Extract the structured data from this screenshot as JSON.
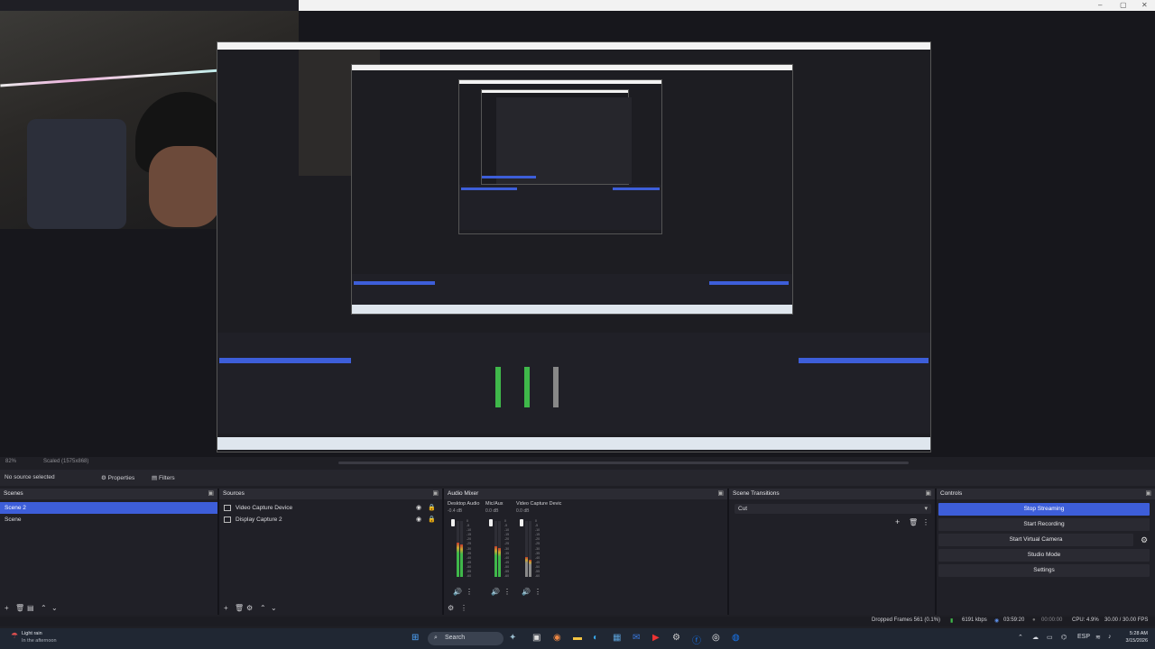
{
  "window": {
    "minimize": "–",
    "maximize": "▢",
    "close": "✕"
  },
  "preview_status": {
    "zoom": "82%",
    "scaled": "Scaled (1575x868)"
  },
  "context_bar": {
    "no_source": "No source selected",
    "properties": "Properties",
    "filters": "Filters"
  },
  "scenes": {
    "title": "Scenes",
    "items": [
      {
        "label": "Scene 2",
        "selected": true
      },
      {
        "label": "Scene",
        "selected": false
      }
    ]
  },
  "sources": {
    "title": "Sources",
    "items": [
      {
        "label": "Video Capture Device"
      },
      {
        "label": "Display Capture 2"
      }
    ]
  },
  "audio_mixer": {
    "title": "Audio Mixer",
    "channels": [
      {
        "name": "Desktop Audio",
        "db": "-0.4 dB",
        "level": 0.62,
        "color": "#3fb84a"
      },
      {
        "name": "Mic/Aux",
        "db": "0.0 dB",
        "level": 0.55,
        "color": "#3fb84a"
      },
      {
        "name": "Video Capture Devic",
        "db": "0.0 dB",
        "level": 0.35,
        "color": "#8a8a8a"
      }
    ],
    "ticks": [
      "0",
      "-5",
      "-10",
      "-15",
      "-20",
      "-25",
      "-30",
      "-35",
      "-40",
      "-45",
      "-50",
      "-55",
      "-60"
    ]
  },
  "scene_transitions": {
    "title": "Scene Transitions",
    "transition": "Cut"
  },
  "controls": {
    "title": "Controls",
    "buttons": [
      "Stop Streaming",
      "Start Recording",
      "Start Virtual Camera",
      "Studio Mode",
      "Settings"
    ]
  },
  "status": {
    "dropped": "Dropped Frames 561 (0.1%)",
    "kbps": "6191 kbps",
    "stream_time": "03:59:20",
    "rec_time": "00:00:00",
    "cpu": "CPU: 4.9%",
    "fps": "30.00 / 30.00 FPS"
  },
  "taskbar": {
    "weather_line1": "Light rain",
    "weather_line2": "In the afternoon",
    "search": "Search",
    "lang": "ESP",
    "time": "5:28 AM",
    "date": "3/15/2026"
  },
  "colors": {
    "accent": "#3d5ed9",
    "meter_green": "#3fb84a",
    "background": "#1f1f25"
  }
}
